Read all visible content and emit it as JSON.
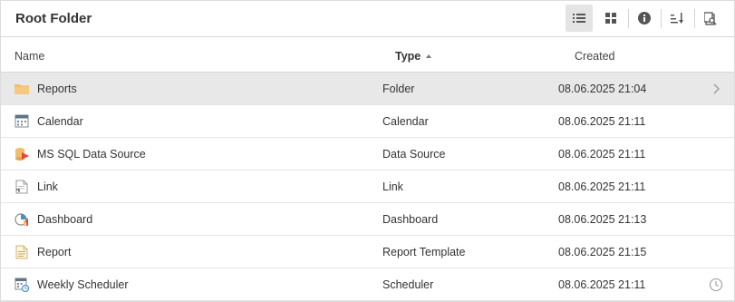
{
  "header": {
    "title": "Root Folder",
    "toolbar": [
      {
        "icon": "list-view-icon",
        "active": true
      },
      {
        "icon": "grid-view-icon",
        "active": false
      },
      {
        "icon": "info-icon",
        "active": false
      },
      {
        "icon": "sort-icon",
        "active": false
      },
      {
        "icon": "search-in-folder-icon",
        "active": false
      }
    ]
  },
  "columns": {
    "name": "Name",
    "type": "Type",
    "created": "Created",
    "sort": {
      "column": "type",
      "direction": "ascending"
    }
  },
  "rows": [
    {
      "icon": "folder-icon",
      "name": "Reports",
      "type": "Folder",
      "created": "08.06.2025 21:04",
      "selected": true,
      "trailing": "chevron-right-icon"
    },
    {
      "icon": "calendar-icon",
      "name": "Calendar",
      "type": "Calendar",
      "created": "08.06.2025 21:11",
      "selected": false,
      "trailing": null
    },
    {
      "icon": "data-source-icon",
      "name": "MS SQL Data Source",
      "type": "Data Source",
      "created": "08.06.2025 21:11",
      "selected": false,
      "trailing": null
    },
    {
      "icon": "link-icon",
      "name": "Link",
      "type": "Link",
      "created": "08.06.2025 21:11",
      "selected": false,
      "trailing": null
    },
    {
      "icon": "dashboard-icon",
      "name": "Dashboard",
      "type": "Dashboard",
      "created": "08.06.2025 21:13",
      "selected": false,
      "trailing": null
    },
    {
      "icon": "report-icon",
      "name": "Report",
      "type": "Report Template",
      "created": "08.06.2025 21:15",
      "selected": false,
      "trailing": null
    },
    {
      "icon": "scheduler-icon",
      "name": "Weekly Scheduler",
      "type": "Scheduler",
      "created": "08.06.2025 21:11",
      "selected": false,
      "trailing": "clock-icon"
    }
  ],
  "colors": {
    "selected_row": "#e8e8e8",
    "folder": "#f2bd6b",
    "icon_gray": "#666666",
    "data_source_accent": "#e8463b"
  }
}
